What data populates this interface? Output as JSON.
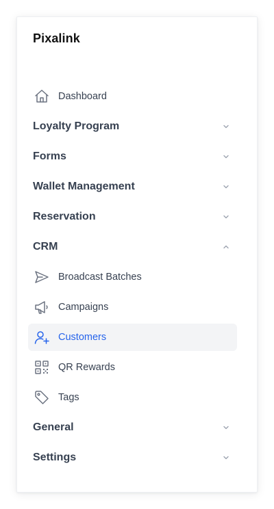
{
  "sidebar": {
    "brand": "Pixalink",
    "dashboard": {
      "label": "Dashboard",
      "icon": "home-icon"
    },
    "sections": {
      "loyalty": {
        "label": "Loyalty Program",
        "expanded": false
      },
      "forms": {
        "label": "Forms",
        "expanded": false
      },
      "wallet": {
        "label": "Wallet Management",
        "expanded": false
      },
      "reservation": {
        "label": "Reservation",
        "expanded": false
      },
      "crm": {
        "label": "CRM",
        "expanded": true
      },
      "general": {
        "label": "General",
        "expanded": false
      },
      "settings": {
        "label": "Settings",
        "expanded": false
      }
    },
    "crm_items": {
      "broadcast": {
        "label": "Broadcast Batches",
        "icon": "send-icon"
      },
      "campaigns": {
        "label": "Campaigns",
        "icon": "megaphone-icon"
      },
      "customers": {
        "label": "Customers",
        "icon": "user-plus-icon",
        "active": true
      },
      "qr_rewards": {
        "label": "QR Rewards",
        "icon": "qr-code-icon"
      },
      "tags": {
        "label": "Tags",
        "icon": "tag-icon"
      }
    }
  },
  "colors": {
    "text": "#374151",
    "brand_text": "#111111",
    "active_text": "#2563eb",
    "active_bg": "#f3f4f6",
    "icon": "#6b7280",
    "chevron": "#9ca3af"
  }
}
